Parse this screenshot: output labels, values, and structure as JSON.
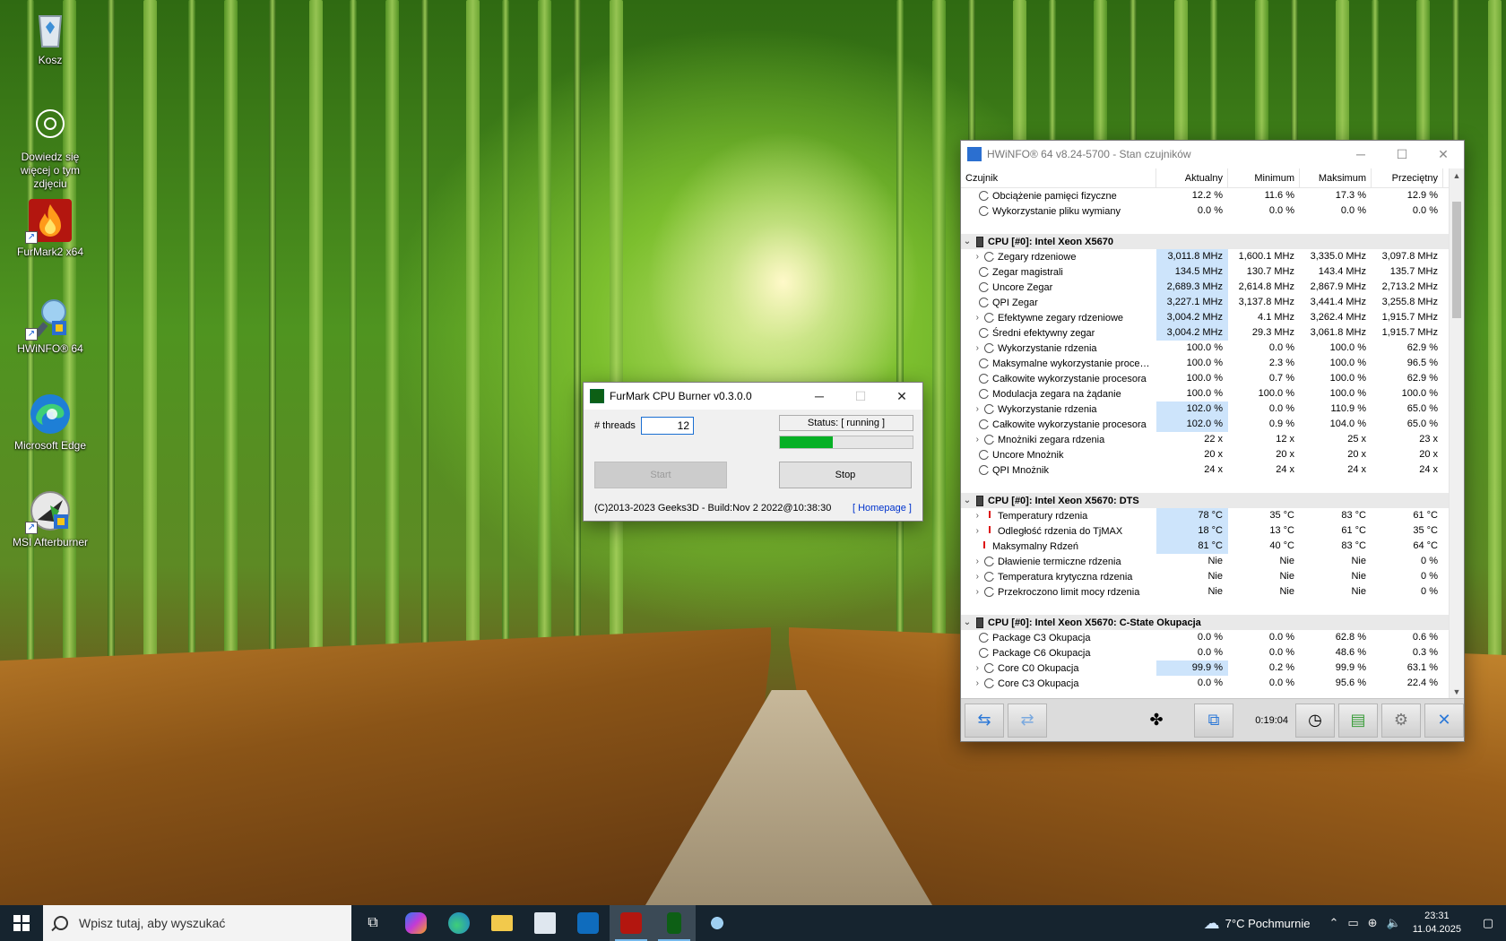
{
  "desktop": {
    "icons": [
      {
        "label": "Kosz"
      },
      {
        "label": "Dowiedz się więcej o tym zdjęciu"
      },
      {
        "label": "FurMark2 x64"
      },
      {
        "label": "HWiNFO® 64"
      },
      {
        "label": "Microsoft Edge"
      },
      {
        "label": "MSI Afterburner"
      }
    ]
  },
  "furmark": {
    "title": "FurMark CPU Burner v0.3.0.0",
    "threads_label": "# threads",
    "threads_value": "12",
    "status": "Status: [ running ]",
    "progress_fraction": 0.4,
    "start_label": "Start",
    "stop_label": "Stop",
    "copyright": "(C)2013-2023 Geeks3D - Build:Nov  2 2022@10:38:30",
    "homepage": "[ Homepage ]"
  },
  "hwinfo": {
    "title": "HWiNFO® 64 v8.24-5700 - Stan czujników",
    "columns": [
      "Czujnik",
      "Aktualny",
      "Minimum",
      "Maksimum",
      "Przeciętny"
    ],
    "rows": [
      {
        "type": "row",
        "indent": 1,
        "icon": "clock",
        "name": "Obciążenie pamięci fizyczne",
        "values": [
          "12.2 %",
          "11.6 %",
          "17.3 %",
          "12.9 %"
        ]
      },
      {
        "type": "row",
        "indent": 1,
        "icon": "clock",
        "name": "Wykorzystanie pliku wymiany",
        "values": [
          "0.0 %",
          "0.0 %",
          "0.0 %",
          "0.0 %"
        ]
      },
      {
        "type": "blank"
      },
      {
        "type": "group",
        "name": "CPU [#0]: Intel Xeon X5670"
      },
      {
        "type": "row",
        "indent": 2,
        "icon": "clock",
        "name": "Zegary rdzeniowe",
        "values": [
          "3,011.8 MHz",
          "1,600.1 MHz",
          "3,335.0 MHz",
          "3,097.8 MHz"
        ],
        "hl": true
      },
      {
        "type": "row",
        "indent": 1,
        "icon": "clock",
        "name": "Zegar magistrali",
        "values": [
          "134.5 MHz",
          "130.7 MHz",
          "143.4 MHz",
          "135.7 MHz"
        ],
        "hl": true
      },
      {
        "type": "row",
        "indent": 1,
        "icon": "clock",
        "name": "Uncore Zegar",
        "values": [
          "2,689.3 MHz",
          "2,614.8 MHz",
          "2,867.9 MHz",
          "2,713.2 MHz"
        ],
        "hl": true
      },
      {
        "type": "row",
        "indent": 1,
        "icon": "clock",
        "name": "QPI Zegar",
        "values": [
          "3,227.1 MHz",
          "3,137.8 MHz",
          "3,441.4 MHz",
          "3,255.8 MHz"
        ],
        "hl": true
      },
      {
        "type": "row",
        "indent": 2,
        "icon": "clock",
        "name": "Efektywne zegary rdzeniowe",
        "values": [
          "3,004.2 MHz",
          "4.1 MHz",
          "3,262.4 MHz",
          "1,915.7 MHz"
        ],
        "hl": true
      },
      {
        "type": "row",
        "indent": 1,
        "icon": "clock",
        "name": "Średni efektywny zegar",
        "values": [
          "3,004.2 MHz",
          "29.3 MHz",
          "3,061.8 MHz",
          "1,915.7 MHz"
        ],
        "hl": true
      },
      {
        "type": "row",
        "indent": 2,
        "icon": "clock",
        "name": "Wykorzystanie rdzenia",
        "values": [
          "100.0 %",
          "0.0 %",
          "100.0 %",
          "62.9 %"
        ]
      },
      {
        "type": "row",
        "indent": 1,
        "icon": "clock",
        "name": "Maksymalne wykorzystanie proce…",
        "values": [
          "100.0 %",
          "2.3 %",
          "100.0 %",
          "96.5 %"
        ]
      },
      {
        "type": "row",
        "indent": 1,
        "icon": "clock",
        "name": "Całkowite wykorzystanie procesora",
        "values": [
          "100.0 %",
          "0.7 %",
          "100.0 %",
          "62.9 %"
        ]
      },
      {
        "type": "row",
        "indent": 1,
        "icon": "clock",
        "name": "Modulacja zegara na żądanie",
        "values": [
          "100.0 %",
          "100.0 %",
          "100.0 %",
          "100.0 %"
        ]
      },
      {
        "type": "row",
        "indent": 2,
        "icon": "clock",
        "name": "Wykorzystanie rdzenia",
        "values": [
          "102.0 %",
          "0.0 %",
          "110.9 %",
          "65.0 %"
        ],
        "hl": true
      },
      {
        "type": "row",
        "indent": 1,
        "icon": "clock",
        "name": "Całkowite wykorzystanie procesora",
        "values": [
          "102.0 %",
          "0.9 %",
          "104.0 %",
          "65.0 %"
        ],
        "hl": true
      },
      {
        "type": "row",
        "indent": 2,
        "icon": "clock",
        "name": "Mnożniki zegara rdzenia",
        "values": [
          "22 x",
          "12 x",
          "25 x",
          "23 x"
        ]
      },
      {
        "type": "row",
        "indent": 1,
        "icon": "clock",
        "name": "Uncore Mnożnik",
        "values": [
          "20 x",
          "20 x",
          "20 x",
          "20 x"
        ]
      },
      {
        "type": "row",
        "indent": 1,
        "icon": "clock",
        "name": "QPI Mnożnik",
        "values": [
          "24 x",
          "24 x",
          "24 x",
          "24 x"
        ]
      },
      {
        "type": "blank"
      },
      {
        "type": "group",
        "name": "CPU [#0]: Intel Xeon X5670: DTS"
      },
      {
        "type": "row",
        "indent": 2,
        "icon": "therm",
        "name": "Temperatury rdzenia",
        "values": [
          "78 °C",
          "35 °C",
          "83 °C",
          "61 °C"
        ],
        "hl": true
      },
      {
        "type": "row",
        "indent": 2,
        "icon": "therm",
        "name": "Odległość rdzenia do TjMAX",
        "values": [
          "18 °C",
          "13 °C",
          "61 °C",
          "35 °C"
        ],
        "hl": true
      },
      {
        "type": "row",
        "indent": 1,
        "icon": "therm",
        "name": "Maksymalny Rdzeń",
        "values": [
          "81 °C",
          "40 °C",
          "83 °C",
          "64 °C"
        ],
        "hl": true
      },
      {
        "type": "row",
        "indent": 2,
        "icon": "clock",
        "name": "Dławienie termiczne rdzenia",
        "values": [
          "Nie",
          "Nie",
          "Nie",
          "0 %"
        ]
      },
      {
        "type": "row",
        "indent": 2,
        "icon": "clock",
        "name": "Temperatura krytyczna rdzenia",
        "values": [
          "Nie",
          "Nie",
          "Nie",
          "0 %"
        ]
      },
      {
        "type": "row",
        "indent": 2,
        "icon": "clock",
        "name": "Przekroczono limit mocy rdzenia",
        "values": [
          "Nie",
          "Nie",
          "Nie",
          "0 %"
        ]
      },
      {
        "type": "blank"
      },
      {
        "type": "group",
        "name": "CPU [#0]: Intel Xeon X5670: C-State Okupacja"
      },
      {
        "type": "row",
        "indent": 1,
        "icon": "clock",
        "name": "Package C3 Okupacja",
        "values": [
          "0.0 %",
          "0.0 %",
          "62.8 %",
          "0.6 %"
        ]
      },
      {
        "type": "row",
        "indent": 1,
        "icon": "clock",
        "name": "Package C6 Okupacja",
        "values": [
          "0.0 %",
          "0.0 %",
          "48.6 %",
          "0.3 %"
        ]
      },
      {
        "type": "row",
        "indent": 2,
        "icon": "clock",
        "name": "Core C0 Okupacja",
        "values": [
          "99.9 %",
          "0.2 %",
          "99.9 %",
          "63.1 %"
        ],
        "hl": true
      },
      {
        "type": "row",
        "indent": 2,
        "icon": "clock",
        "name": "Core C3 Okupacja",
        "values": [
          "0.0 %",
          "0.0 %",
          "95.6 %",
          "22.4 %"
        ]
      }
    ],
    "elapsed": "0:19:04"
  },
  "taskbar": {
    "search_placeholder": "Wpisz tutaj, aby wyszukać",
    "weather": "7°C  Pochmurnie",
    "time": "23:31",
    "date": "11.04.2025"
  }
}
